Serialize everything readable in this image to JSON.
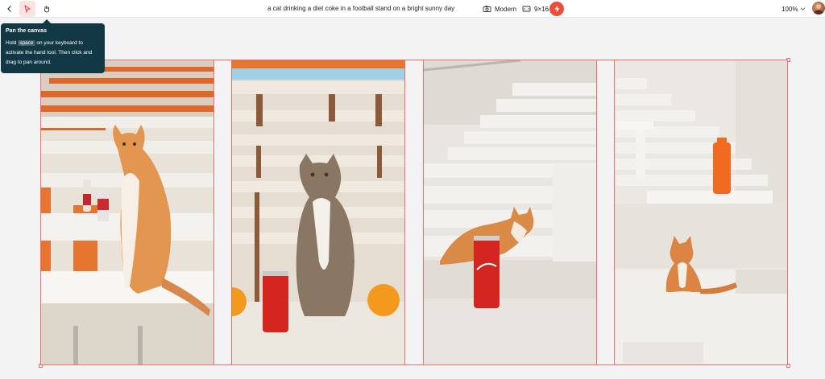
{
  "toolbar": {
    "back_icon": "chevron-left-icon",
    "select_icon": "pointer-arrow-icon",
    "hand_icon": "hand-tool-icon",
    "prompt_text": "a cat drinking a diet coke in a football stand on a bright sunny day",
    "style_icon": "camera-icon",
    "style_label": "Modern",
    "ratio_icon": "aspect-ratio-icon",
    "ratio_label": "9×16",
    "generate_icon": "lightning-icon",
    "zoom_label": "100%",
    "zoom_icon": "chevron-down-icon"
  },
  "tooltip": {
    "title": "Pan the canvas",
    "body_pre": "Hold ",
    "key": "space",
    "body_post": " on your keyboard to activate the hand tool. Then click and drag to pan around."
  },
  "images": [
    {
      "name": "generated-image-1",
      "subject": "orange cat on stadium bench with two cola cans"
    },
    {
      "name": "generated-image-2",
      "subject": "tabby cat sitting on steps with red can and oranges"
    },
    {
      "name": "generated-image-3",
      "subject": "orange cat lying on stairs beside red cola can"
    },
    {
      "name": "generated-image-4",
      "subject": "orange cat on concrete steps with orange bottle"
    }
  ],
  "colors": {
    "accent": "#ef4b3b",
    "selection": "#ef6f6f",
    "tooltip_bg": "#123845"
  }
}
